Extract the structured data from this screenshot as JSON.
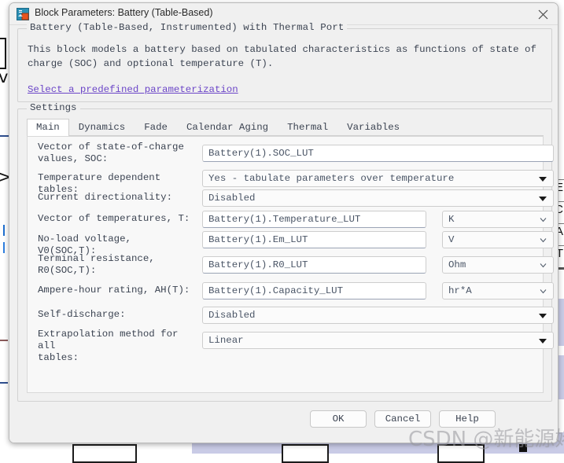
{
  "window": {
    "title": "Block Parameters: Battery (Table-Based)",
    "icon": "simulink-block-icon",
    "close_icon": "close-icon"
  },
  "description": {
    "group_title": "Battery (Table-Based, Instrumented) with Thermal Port",
    "body": "This block models a battery based on tabulated characteristics as functions of state of charge (SOC) and optional temperature (T).",
    "link": "Select a predefined parameterization"
  },
  "settings": {
    "group_title": "Settings",
    "tabs": [
      {
        "label": "Main",
        "active": true
      },
      {
        "label": "Dynamics",
        "active": false
      },
      {
        "label": "Fade",
        "active": false
      },
      {
        "label": "Calendar Aging",
        "active": false
      },
      {
        "label": "Thermal",
        "active": false
      },
      {
        "label": "Variables",
        "active": false
      }
    ],
    "fields": [
      {
        "label": "Vector of state-of-charge values, SOC:",
        "label_line1": "Vector of state-of-charge",
        "label_line2": "values, SOC:",
        "control": "text",
        "value": "Battery(1).SOC_LUT",
        "unit": null
      },
      {
        "label": "Temperature dependent tables:",
        "label_line1": "Temperature dependent tables:",
        "label_line2": "",
        "control": "combo",
        "value": "Yes - tabulate parameters over temperature",
        "unit": null
      },
      {
        "label": "Current directionality:",
        "label_line1": "Current directionality:",
        "label_line2": "",
        "control": "combo",
        "value": "Disabled",
        "unit": null
      },
      {
        "label": "Vector of temperatures, T:",
        "label_line1": "Vector of temperatures, T:",
        "label_line2": "",
        "control": "text",
        "value": "Battery(1).Temperature_LUT",
        "unit": "K"
      },
      {
        "label": "No-load voltage, V0(SOC,T):",
        "label_line1": "No-load voltage, V0(SOC,T):",
        "label_line2": "",
        "control": "text",
        "value": "Battery(1).Em_LUT",
        "unit": "V"
      },
      {
        "label": "Terminal resistance, R0(SOC,T):",
        "label_line1": "Terminal resistance,",
        "label_line2": "R0(SOC,T):",
        "control": "text",
        "value": "Battery(1).R0_LUT",
        "unit": "Ohm"
      },
      {
        "label": "Ampere-hour rating, AH(T):",
        "label_line1": "Ampere-hour rating, AH(T):",
        "label_line2": "",
        "control": "text",
        "value": "Battery(1).Capacity_LUT",
        "unit": "hr*A"
      },
      {
        "label": "Self-discharge:",
        "label_line1": "Self-discharge:",
        "label_line2": "",
        "control": "combo",
        "value": "Disabled",
        "unit": null
      },
      {
        "label": "Extrapolation method for all tables:",
        "label_line1": "Extrapolation method for all",
        "label_line2": "tables:",
        "control": "combo",
        "value": "Linear",
        "unit": null
      }
    ]
  },
  "footer": {
    "ok": "OK",
    "cancel": "Cancel",
    "help": "Help"
  },
  "watermark": {
    "text": "CSDN @新能源姥大"
  },
  "background": {
    "port_labels": [
      "E",
      "C",
      "A",
      "T"
    ]
  },
  "colors": {
    "dialog_bg": "#f0f0f0",
    "panel_bg": "#f8f8f8",
    "text": "#3c4452",
    "value_text": "#4a5566",
    "link": "#6c46c8",
    "border": "#cdcdcd",
    "canvas": "#c9cbe6"
  }
}
